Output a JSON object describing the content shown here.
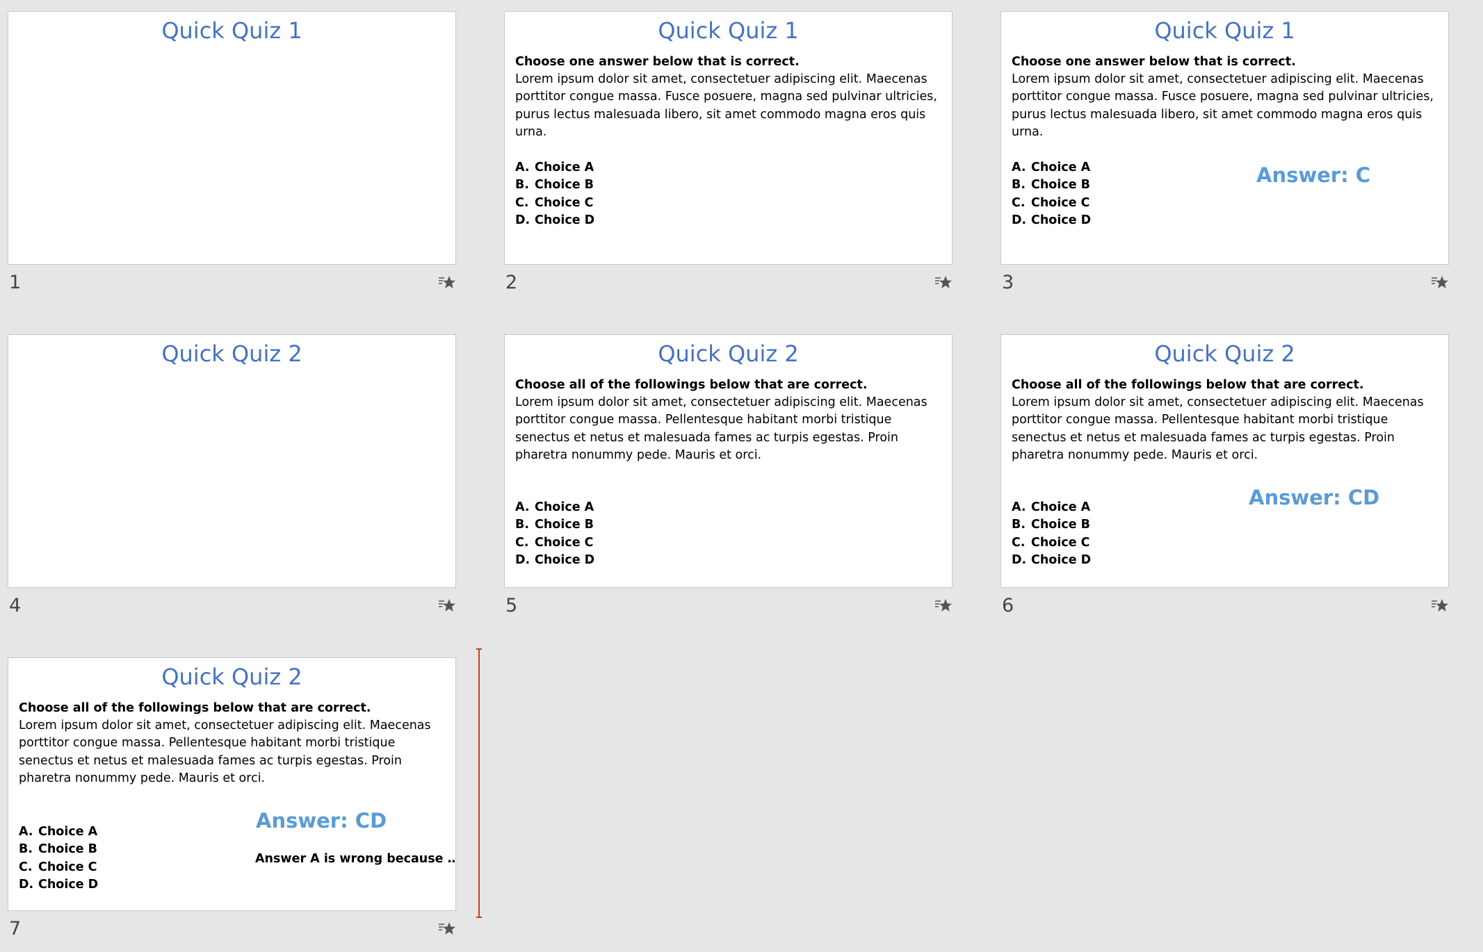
{
  "colors": {
    "background": "#e6e6e6",
    "slide_title": "#4472c4",
    "answer": "#5b9bd5",
    "insert_marker": "#d03a1e"
  },
  "transition_icon": "transition-star-icon",
  "slides": [
    {
      "number": "1",
      "title": "Quick Quiz 1"
    },
    {
      "number": "2",
      "title": "Quick Quiz 1",
      "instruction": "Choose one answer below that is correct.",
      "question": "Lorem ipsum dolor sit amet, consectetuer adipiscing elit. Maecenas porttitor congue massa. Fusce posuere, magna sed pulvinar ultricies, purus lectus malesuada libero, sit amet commodo magna eros quis urna.",
      "choices": [
        {
          "letter": "A.",
          "text": "Choice A"
        },
        {
          "letter": "B.",
          "text": "Choice B"
        },
        {
          "letter": "C.",
          "text": "Choice C"
        },
        {
          "letter": "D.",
          "text": "Choice D"
        }
      ]
    },
    {
      "number": "3",
      "title": "Quick Quiz 1",
      "instruction": "Choose one answer below that is correct.",
      "question": "Lorem ipsum dolor sit amet, consectetuer adipiscing elit. Maecenas porttitor congue massa. Fusce posuere, magna sed pulvinar ultricies, purus lectus malesuada libero, sit amet commodo magna eros quis urna.",
      "choices": [
        {
          "letter": "A.",
          "text": "Choice A"
        },
        {
          "letter": "B.",
          "text": "Choice B"
        },
        {
          "letter": "C.",
          "text": "Choice C"
        },
        {
          "letter": "D.",
          "text": "Choice D"
        }
      ],
      "answer": "Answer: C"
    },
    {
      "number": "4",
      "title": "Quick Quiz 2"
    },
    {
      "number": "5",
      "title": "Quick Quiz 2",
      "instruction": "Choose all of the followings below that are correct.",
      "question": "Lorem ipsum dolor sit amet, consectetuer adipiscing elit. Maecenas porttitor congue massa. Pellentesque habitant morbi tristique senectus et netus et malesuada fames ac turpis egestas. Proin pharetra nonummy pede. Mauris et orci.",
      "choices": [
        {
          "letter": "A.",
          "text": "Choice A"
        },
        {
          "letter": "B.",
          "text": "Choice B"
        },
        {
          "letter": "C.",
          "text": "Choice C"
        },
        {
          "letter": "D.",
          "text": "Choice D"
        }
      ]
    },
    {
      "number": "6",
      "title": "Quick Quiz 2",
      "instruction": "Choose all of the followings below that are correct.",
      "question": "Lorem ipsum dolor sit amet, consectetuer adipiscing elit. Maecenas porttitor congue massa. Pellentesque habitant morbi tristique senectus et netus et malesuada fames ac turpis egestas. Proin pharetra nonummy pede. Mauris et orci.",
      "choices": [
        {
          "letter": "A.",
          "text": "Choice A"
        },
        {
          "letter": "B.",
          "text": "Choice B"
        },
        {
          "letter": "C.",
          "text": "Choice C"
        },
        {
          "letter": "D.",
          "text": "Choice D"
        }
      ],
      "answer": "Answer: CD"
    },
    {
      "number": "7",
      "title": "Quick Quiz 2",
      "instruction": "Choose all of the followings below that are correct.",
      "question": "Lorem ipsum dolor sit amet, consectetuer adipiscing elit. Maecenas porttitor congue massa. Pellentesque habitant morbi tristique senectus et netus et malesuada fames ac turpis egestas. Proin pharetra nonummy pede. Mauris et orci.",
      "choices": [
        {
          "letter": "A.",
          "text": "Choice A"
        },
        {
          "letter": "B.",
          "text": "Choice B"
        },
        {
          "letter": "C.",
          "text": "Choice C"
        },
        {
          "letter": "D.",
          "text": "Choice D"
        }
      ],
      "answer": "Answer: CD",
      "explanation": "Answer A is wrong because …."
    }
  ]
}
